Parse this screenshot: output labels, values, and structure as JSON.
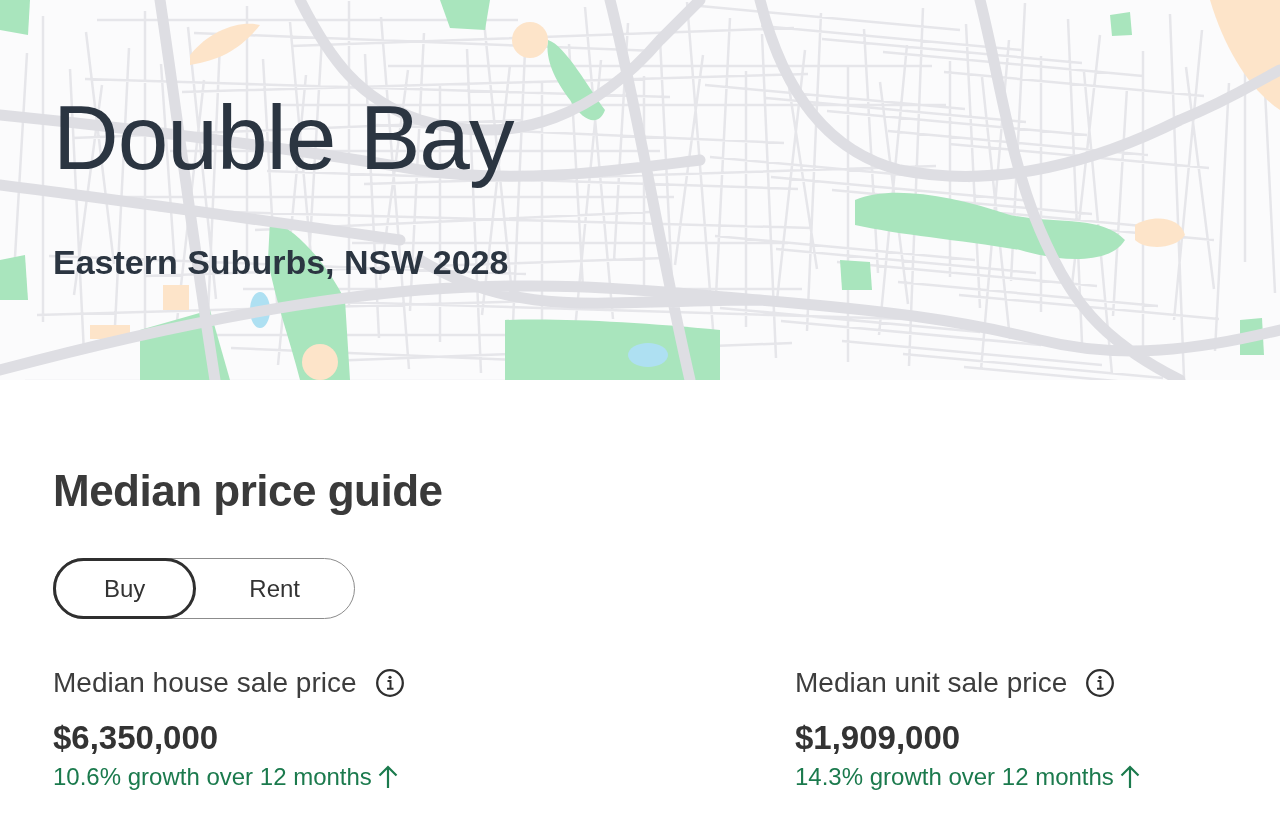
{
  "hero": {
    "title": "Double Bay",
    "subtitle": "Eastern Suburbs, NSW 2028"
  },
  "price_guide": {
    "title": "Median price guide",
    "tabs": [
      {
        "label": "Buy",
        "selected": true
      },
      {
        "label": "Rent",
        "selected": false
      }
    ],
    "stats": [
      {
        "label": "Median house sale price",
        "value": "$6,350,000",
        "growth": "10.6% growth over 12 months"
      },
      {
        "label": "Median unit sale price",
        "value": "$1,909,000",
        "growth": "14.3% growth over 12 months"
      }
    ]
  }
}
